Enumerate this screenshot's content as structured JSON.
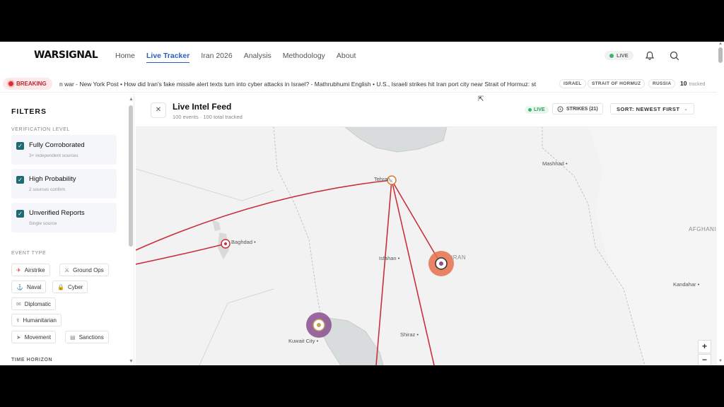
{
  "header": {
    "logo": "WARSIGNAL",
    "nav": [
      "Home",
      "Live Tracker",
      "Iran 2026",
      "Analysis",
      "Methodology",
      "About"
    ],
    "active_nav": "Live Tracker",
    "live_label": "LIVE"
  },
  "ticker": {
    "breaking_label": "BREAKING",
    "text": "n war - New York Post • How did Iran's fake missile alert texts turn into cyber attacks in Israel? - Mathrubhumi English • U.S., Israeli strikes hit Iran port city near Strait of Hormuz: st",
    "tags": [
      "ISRAEL",
      "STRAIT OF HORMUZ",
      "RUSSIA"
    ],
    "tracked_count": "10",
    "tracked_label": "tracked"
  },
  "sidebar": {
    "title": "FILTERS",
    "verification_label": "VERIFICATION LEVEL",
    "verification": [
      {
        "label": "Fully Corroborated",
        "sub": "3+ independent sources"
      },
      {
        "label": "High Probability",
        "sub": "2 sources confirm"
      },
      {
        "label": "Unverified Reports",
        "sub": "Single source"
      }
    ],
    "event_type_label": "EVENT TYPE",
    "event_types": [
      {
        "label": "Airstrike",
        "icon": "✈"
      },
      {
        "label": "Ground Ops",
        "icon": "⚔"
      },
      {
        "label": "Naval",
        "icon": "⚓"
      },
      {
        "label": "Cyber",
        "icon": "🔒"
      },
      {
        "label": "Diplomatic",
        "icon": "✉"
      },
      {
        "label": "Humanitarian",
        "icon": "⚕"
      },
      {
        "label": "Movement",
        "icon": "➤"
      },
      {
        "label": "Sanctions",
        "icon": "▤"
      }
    ],
    "time_horizon_label": "TIME HORIZON"
  },
  "feed": {
    "title": "Live Intel Feed",
    "subtitle": "100 events · 100 total tracked",
    "live_label": "LIVE",
    "strikes_label": "STRIKES (21)",
    "sort_label": "SORT: NEWEST FIRST"
  },
  "map": {
    "cities": [
      "Tehran",
      "Mashhad",
      "Baghdad",
      "Isfahan",
      "Shiraz",
      "Kuwait City",
      "Kandahar"
    ],
    "countries": [
      "IRAN",
      "AFGHANI"
    ],
    "zoom_in": "+",
    "zoom_out": "−",
    "colors": {
      "strike_line": "#c8313b",
      "marker_orange": "#e8704e",
      "marker_purple": "#8a4f8e"
    }
  }
}
